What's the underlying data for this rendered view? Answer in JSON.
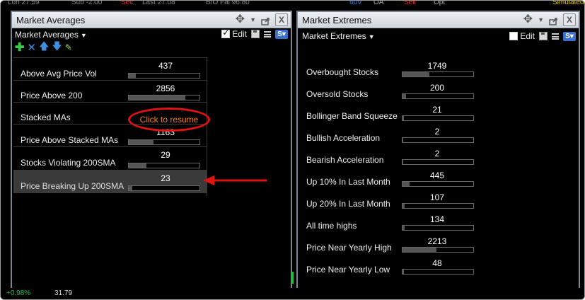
{
  "ticker_top": {
    "items": [
      {
        "text": "Loh 27.59",
        "color": "#8a8a8a"
      },
      {
        "text": "Sub -2.00",
        "color": "#8a8a8a"
      },
      {
        "text": "Sec",
        "color": "#d33"
      },
      {
        "text": "Last 27.08",
        "color": "#8a8a8a"
      },
      {
        "text": "B/O Fal 96.80",
        "color": "#8a8a8a"
      },
      {
        "text": "60V",
        "color": "#3b7ad9"
      },
      {
        "text": "OA",
        "color": "#aaaaaa"
      },
      {
        "text": "Sell",
        "color": "#d33"
      },
      {
        "text": "Opt",
        "color": "#aaaaaa"
      },
      {
        "text": "Simulated B",
        "color": "#e6c800"
      }
    ]
  },
  "ticker_bottom": {
    "items": [
      {
        "text": "+0.98%",
        "color": "#23c04a"
      },
      {
        "text": "31.79",
        "color": "#dddddd"
      }
    ]
  },
  "market_averages": {
    "title": "Market Averages",
    "dropdown_label": "Market Averages",
    "edit_label": "Edit",
    "edit_checked": true,
    "s_button": "S",
    "close_label": "X",
    "rows": [
      {
        "label": "Above Avg Price Vol",
        "value": "437",
        "fill": 0.1
      },
      {
        "label": "Price Above 200",
        "value": "2856",
        "fill": 0.8
      },
      {
        "label": "Stacked MAs",
        "value": "",
        "fill": 0
      },
      {
        "label": "Price Above Stacked MAs",
        "value": "1163",
        "fill": 0.35
      },
      {
        "label": "Stocks Violating 200SMA",
        "value": "29",
        "fill": 0.25
      },
      {
        "label": "Price Breaking Up 200SMA",
        "value": "23",
        "fill": 0.05
      }
    ],
    "resume_label": "Click to resume",
    "selected_row": 5
  },
  "market_extremes": {
    "title": "Market Extremes",
    "dropdown_label": "Market Extremes",
    "edit_label": "Edit",
    "edit_checked": false,
    "s_button": "S",
    "close_label": "X",
    "rows": [
      {
        "label": "Overbought Stocks",
        "value": "1749",
        "fill": 0.38
      },
      {
        "label": "Oversold Stocks",
        "value": "200",
        "fill": 0.05
      },
      {
        "label": "Bollinger Band Squeeze",
        "value": "21",
        "fill": 0.02
      },
      {
        "label": "Bullish Acceleration",
        "value": "2",
        "fill": 0.01
      },
      {
        "label": "Bearish Acceleration",
        "value": "2",
        "fill": 0.01
      },
      {
        "label": "Up 10% In Last Month",
        "value": "445",
        "fill": 0.1
      },
      {
        "label": "Up 20% In Last Month",
        "value": "107",
        "fill": 0.03
      },
      {
        "label": "All time highs",
        "value": "134",
        "fill": 0.03
      },
      {
        "label": "Price Near Yearly High",
        "value": "2213",
        "fill": 0.48
      },
      {
        "label": "Price Near Yearly Low",
        "value": "48",
        "fill": 0.02
      }
    ]
  },
  "colors": {
    "annotation_red": "#e21212",
    "resume_orange": "#f07e1b",
    "accent_blue": "#3a6fd0"
  }
}
